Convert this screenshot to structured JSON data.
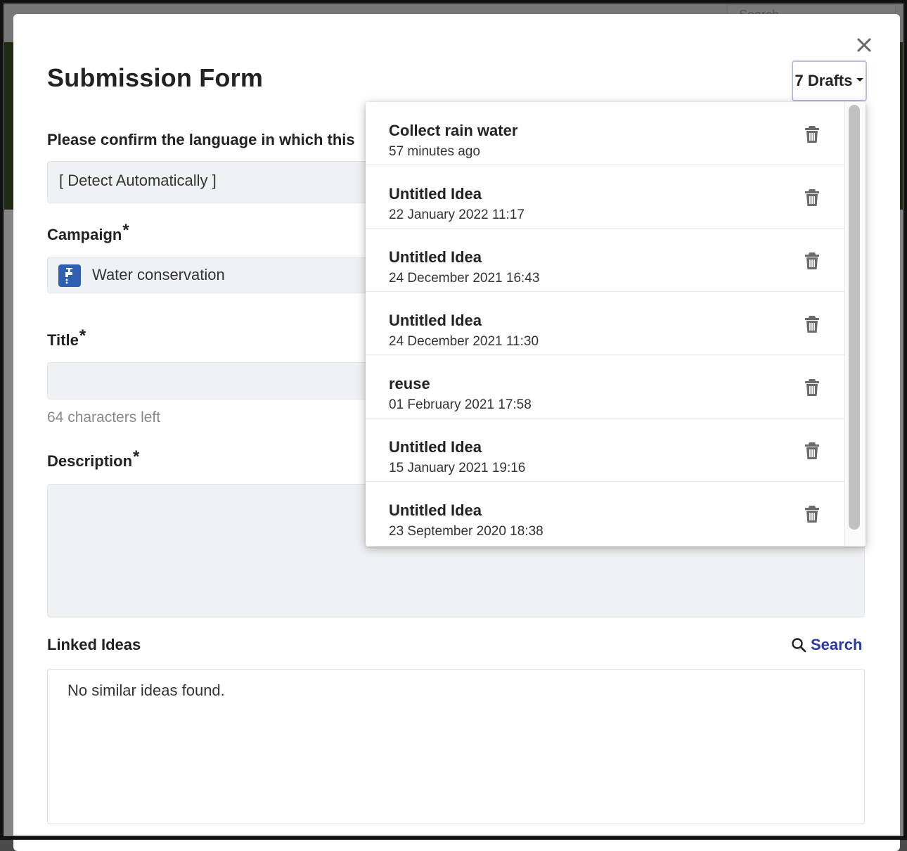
{
  "background": {
    "search_placeholder": "Search"
  },
  "modal": {
    "title": "Submission Form",
    "drafts_button_label": "7 Drafts"
  },
  "form": {
    "language": {
      "label": "Please confirm the language in which this",
      "value": "[ Detect Automatically ]"
    },
    "campaign": {
      "label": "Campaign",
      "required_mark": "*",
      "value": "Water conservation",
      "icon": "faucet-icon"
    },
    "title": {
      "label": "Title",
      "required_mark": "*",
      "value": "",
      "chars_left": "64 characters left"
    },
    "description": {
      "label": "Description",
      "required_mark": "*",
      "value": ""
    },
    "linked_ideas": {
      "label": "Linked Ideas",
      "search_label": "Search",
      "empty_text": "No similar ideas found."
    }
  },
  "drafts": [
    {
      "title": "Collect rain water",
      "date": "57 minutes ago"
    },
    {
      "title": "Untitled Idea",
      "date": "22 January 2022 11:17"
    },
    {
      "title": "Untitled Idea",
      "date": "24 December 2021 16:43"
    },
    {
      "title": "Untitled Idea",
      "date": "24 December 2021 11:30"
    },
    {
      "title": "reuse",
      "date": "01 February 2021 17:58"
    },
    {
      "title": "Untitled Idea",
      "date": "15 January 2021 19:16"
    },
    {
      "title": "Untitled Idea",
      "date": "23 September 2020 18:38"
    }
  ],
  "colors": {
    "link": "#2b3a9e",
    "field_bg": "#f0f1f4",
    "campaign_icon_bg": "#2f5fb0"
  }
}
